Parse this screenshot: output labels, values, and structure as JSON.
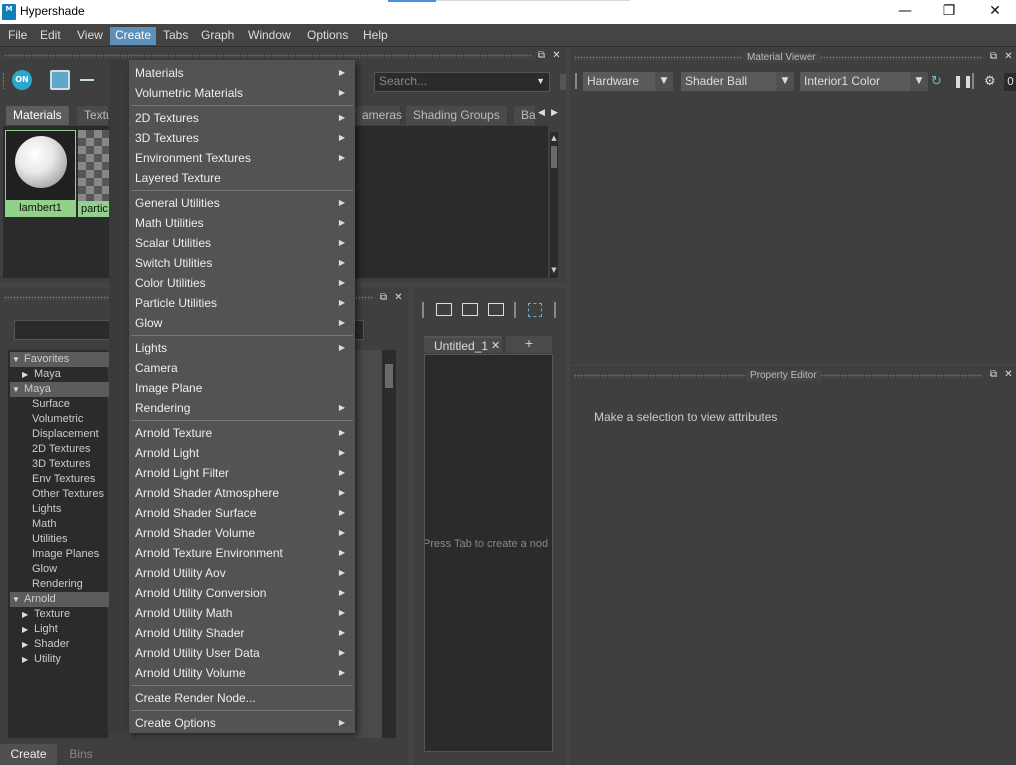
{
  "window": {
    "title": "Hypershade",
    "app_icon_label": "M"
  },
  "menubar": [
    "File",
    "Edit",
    "View",
    "Create",
    "Tabs",
    "Graph",
    "Window",
    "Options",
    "Help"
  ],
  "browser": {
    "toolbar": {
      "toggle_label": "ON",
      "search_placeholder": "Search..."
    },
    "tabs": [
      "Materials",
      "Textu",
      "ameras",
      "Shading Groups",
      "Ba"
    ],
    "swatches": [
      "lambert1",
      "partic"
    ]
  },
  "create_tree": {
    "rows": [
      {
        "label": "Favorites",
        "group": true,
        "expanded": true
      },
      {
        "label": "Maya",
        "group": false,
        "expandable": true
      },
      {
        "label": "Maya",
        "group": true,
        "expanded": true
      },
      {
        "label": "Surface"
      },
      {
        "label": "Volumetric"
      },
      {
        "label": "Displacement"
      },
      {
        "label": "2D Textures"
      },
      {
        "label": "3D Textures"
      },
      {
        "label": "Env Textures"
      },
      {
        "label": "Other Textures"
      },
      {
        "label": "Lights"
      },
      {
        "label": "Math"
      },
      {
        "label": "Utilities"
      },
      {
        "label": "Image Planes"
      },
      {
        "label": "Glow"
      },
      {
        "label": "Rendering"
      },
      {
        "label": "Arnold",
        "group": true,
        "expanded": true
      },
      {
        "label": "Texture",
        "expandable": true
      },
      {
        "label": "Light",
        "expandable": true
      },
      {
        "label": "Shader",
        "expandable": true
      },
      {
        "label": "Utility",
        "expandable": true
      }
    ],
    "bottom_tabs": [
      "Create",
      "Bins"
    ]
  },
  "node_editor": {
    "tab": "Untitled_1",
    "add_tab": "+",
    "hint": "Press Tab to create a nod"
  },
  "material_viewer": {
    "title": "Material Viewer",
    "renderer": "Hardware",
    "geometry": "Shader Ball",
    "environment": "Interior1 Color",
    "frame": "0"
  },
  "property_editor": {
    "title": "Property Editor",
    "message": "Make a selection to view attributes"
  },
  "create_menu": {
    "groups": [
      [
        {
          "label": "Materials",
          "sub": true
        },
        {
          "label": "Volumetric Materials",
          "sub": true
        }
      ],
      [
        {
          "label": "2D Textures",
          "sub": true
        },
        {
          "label": "3D Textures",
          "sub": true
        },
        {
          "label": "Environment Textures",
          "sub": true
        },
        {
          "label": "Layered Texture",
          "sub": false
        }
      ],
      [
        {
          "label": "General Utilities",
          "sub": true
        },
        {
          "label": "Math Utilities",
          "sub": true
        },
        {
          "label": "Scalar Utilities",
          "sub": true
        },
        {
          "label": "Switch Utilities",
          "sub": true
        },
        {
          "label": "Color Utilities",
          "sub": true
        },
        {
          "label": "Particle Utilities",
          "sub": true
        },
        {
          "label": "Glow",
          "sub": true
        }
      ],
      [
        {
          "label": "Lights",
          "sub": true
        },
        {
          "label": "Camera",
          "sub": false
        },
        {
          "label": "Image Plane",
          "sub": false
        },
        {
          "label": "Rendering",
          "sub": true
        }
      ],
      [
        {
          "label": "Arnold Texture",
          "sub": true
        },
        {
          "label": "Arnold Light",
          "sub": true
        },
        {
          "label": "Arnold Light Filter",
          "sub": true
        },
        {
          "label": "Arnold Shader Atmosphere",
          "sub": true
        },
        {
          "label": "Arnold Shader Surface",
          "sub": true
        },
        {
          "label": "Arnold Shader Volume",
          "sub": true
        },
        {
          "label": "Arnold Texture Environment",
          "sub": true
        },
        {
          "label": "Arnold Utility Aov",
          "sub": true
        },
        {
          "label": "Arnold Utility Conversion",
          "sub": true
        },
        {
          "label": "Arnold Utility Math",
          "sub": true
        },
        {
          "label": "Arnold Utility Shader",
          "sub": true
        },
        {
          "label": "Arnold Utility User Data",
          "sub": true
        },
        {
          "label": "Arnold Utility Volume",
          "sub": true
        }
      ],
      [
        {
          "label": "Create Render Node...",
          "sub": false
        }
      ],
      [
        {
          "label": "Create Options",
          "sub": true
        }
      ]
    ]
  },
  "colors": {
    "menu_highlight": "#5d8fb8",
    "swatch_label_bg": "#91d18b",
    "toggle_on": "#2aa7c9"
  }
}
